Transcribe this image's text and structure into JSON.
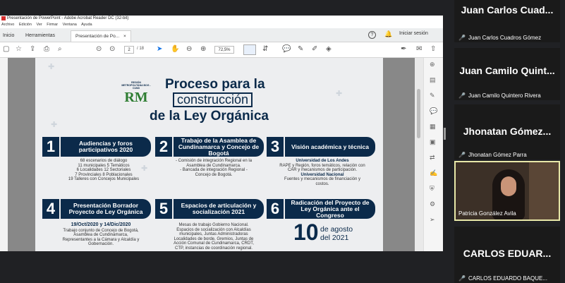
{
  "window": {
    "title": "Presentación de PowerPoint - Adobe Acrobat Reader DC (32-bit)"
  },
  "menu": [
    "Archivo",
    "Edición",
    "Ver",
    "Firmar",
    "Ventana",
    "Ayuda"
  ],
  "tabs": {
    "home": "Inicio",
    "tools": "Herramientas",
    "doc": "Presentación de Po...",
    "close": "×"
  },
  "header": {
    "help": "?",
    "login": "Iniciar sesión"
  },
  "toolbar": {
    "page_current": "2",
    "page_total": "/ 18",
    "zoom": "72,5%"
  },
  "doc": {
    "logo_text": "REGIÓN METROPOLITANA BOG - CUND",
    "logo_mark": "RM",
    "title_line1": "Proceso para la",
    "title_line2": "construcción",
    "title_line3": "de la Ley Orgánica",
    "items": [
      {
        "num": "1",
        "title": "Audiencias y foros participativos 2020",
        "desc_lines": [
          "68 escenarios de diálogo",
          "11 municipales   5 Temáticos",
          "6 Localidades   12 Sectoriales",
          "7 Provinciales   8 Poblacionales",
          "19 Talleres con Concejos Municipales"
        ]
      },
      {
        "num": "2",
        "title": "Trabajo de la Asamblea de Cundinamarca y Concejo de Bogotá",
        "desc_lines": [
          "- Comisión de integración Regional en la",
          "Asamblea de Cundinamarca.",
          "- Bancada de integración Regional -",
          "Concejo de Bogotá."
        ]
      },
      {
        "num": "3",
        "title": "Visión académica y técnica",
        "desc_lines": [
          "Universidad de Los Andes",
          "RAPE y Región, foros temáticos, relación con",
          "CAR y mecanismos de participación.",
          "Universidad Nacional",
          "Fuentes y mecanismos de financiación y",
          "costos."
        ]
      },
      {
        "num": "4",
        "title": "Presentación Borrador Proyecto de Ley Orgánica",
        "desc_lines": [
          "19/Oct/2020 y 14/Dic/2020",
          "Trabajo conjunto de Concejo de Bogotá,",
          "Asamblea de Cundinamarca,",
          "Representantes a la Cámara y Alcaldía y",
          "Gobernación."
        ]
      },
      {
        "num": "5",
        "title": "Espacios de articulación y socialización 2021",
        "desc_lines": [
          "Mesas de trabajo Gobierno Nacional.",
          "Espacios de socialización con Alcaldías",
          "municipales, Juntas Administradoras",
          "Localidades de borde, Gremios, Juntas de",
          "Acción Comunal de Cundinamarca, CRDT,",
          "CTP, instancias de coordinación regional."
        ]
      },
      {
        "num": "6",
        "title": "Radicación del Proyecto de Ley Orgánica ante el Congreso",
        "date_day": "10",
        "date_month": "de agosto",
        "date_year": "del 2021"
      }
    ]
  },
  "participants": [
    {
      "big": "Juan Carlos Cuad...",
      "name": "Juan Carlos Cuadros Gómez"
    },
    {
      "big": "Juan Camilo Quint...",
      "name": "Juan Camilo Quintero Rivera"
    },
    {
      "big": "Jhonatan Gómez...",
      "name": "Jhonatan Gómez Parra"
    },
    {
      "big": "",
      "name": "Patricia González Avila"
    },
    {
      "big": "CARLOS EDUAR...",
      "name": "CARLOS EDUARDO BAQUE..."
    }
  ],
  "colors": {
    "navy": "#0b2a4a",
    "mic_muted": "#e02424",
    "active_speaker_border": "#e8e8a8"
  }
}
